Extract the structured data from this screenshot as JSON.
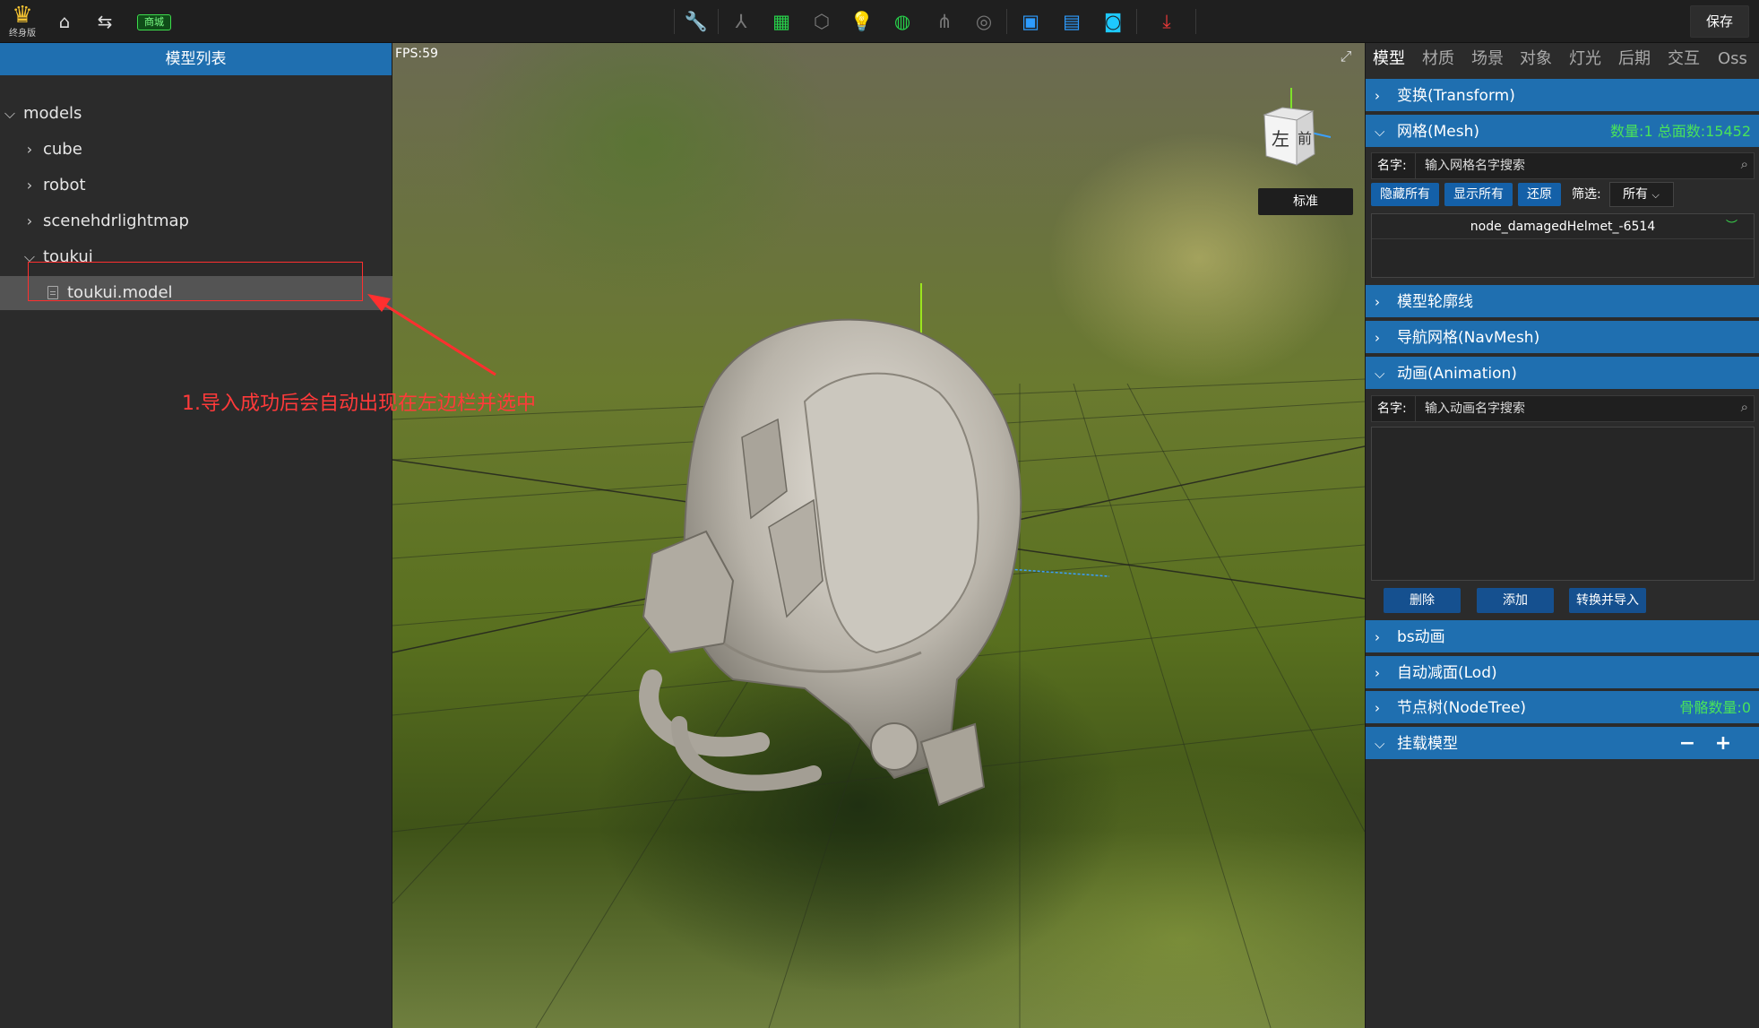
{
  "topbar": {
    "brand_label": "终身版",
    "shop_label": "商城",
    "save_label": "保存",
    "icons": [
      "home-icon",
      "switch-icon",
      "wrench-icon",
      "skeleton-icon",
      "grid-icon",
      "cube-icon",
      "bulb-icon",
      "material-sphere-icon",
      "particle-icon",
      "globe-icon",
      "video-icon",
      "clapper-icon",
      "camera-icon",
      "download-icon"
    ],
    "accent_color": "#1f6fb0"
  },
  "left_panel": {
    "title": "模型列表",
    "tree": [
      {
        "label": "models",
        "expanded": true,
        "level": 0
      },
      {
        "label": "cube",
        "expanded": false,
        "level": 1
      },
      {
        "label": "robot",
        "expanded": false,
        "level": 1
      },
      {
        "label": "scenehdrlightmap",
        "expanded": false,
        "level": 1
      },
      {
        "label": "toukui",
        "expanded": true,
        "level": 1
      },
      {
        "label": "toukui.model",
        "level": 2,
        "selected": true
      }
    ],
    "annotation": "1.导入成功后会自动出现在左边栏并选中"
  },
  "viewport": {
    "fps": "FPS:59",
    "cube_left": "左",
    "cube_front": "前",
    "standard_label": "标准"
  },
  "right_panel": {
    "tabs": [
      "模型",
      "材质",
      "场景",
      "对象",
      "灯光",
      "后期",
      "交互",
      "Oss"
    ],
    "active_tab": "模型",
    "sections": {
      "transform": "变换(Transform)",
      "mesh": "网格(Mesh)",
      "mesh_stats": "数量:1 总面数:15452",
      "outline": "模型轮廓线",
      "navmesh": "导航网格(NavMesh)",
      "animation": "动画(Animation)",
      "bs_anim": "bs动画",
      "lod": "自动减面(Lod)",
      "nodetree": "节点树(NodeTree)",
      "bone_count": "骨骼数量:0",
      "attach": "挂载模型"
    },
    "mesh_panel": {
      "name_label": "名字:",
      "search_placeholder": "输入网格名字搜索",
      "hide_all": "隐藏所有",
      "show_all": "显示所有",
      "restore": "还原",
      "filter_label": "筛选:",
      "filter_value": "所有",
      "items": [
        "node_damagedHelmet_-6514"
      ]
    },
    "animation_panel": {
      "name_label": "名字:",
      "search_placeholder": "输入动画名字搜索",
      "delete": "删除",
      "add": "添加",
      "convert_import": "转换并导入"
    }
  }
}
